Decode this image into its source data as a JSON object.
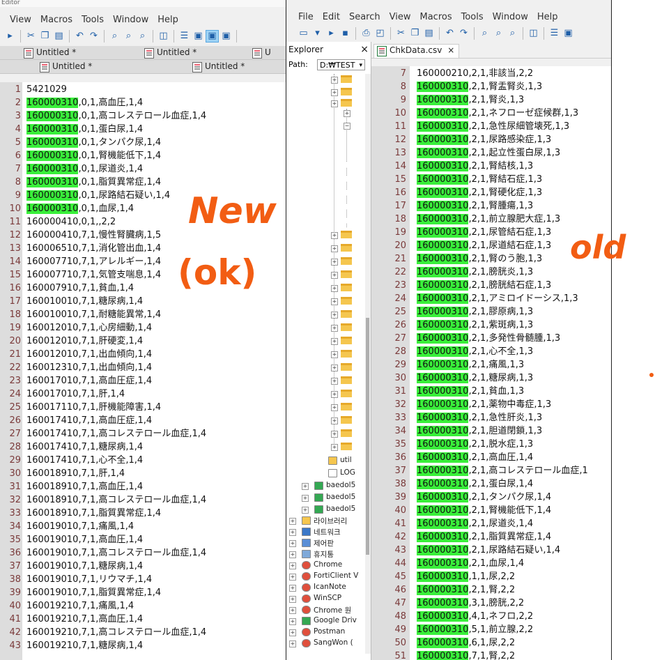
{
  "left_window": {
    "title_fragment": "Editor",
    "menu": [
      "View",
      "Macros",
      "Tools",
      "Window",
      "Help"
    ],
    "tabs_row1": [
      "Untitled *",
      "Untitled *",
      "U"
    ],
    "tabs_row2": [
      "Untitled *",
      "Untitled *"
    ],
    "lines": [
      {
        "n": "1",
        "hl": "",
        "rest": "5421029"
      },
      {
        "n": "2",
        "hl": "160000310",
        "rest": ",0,1,高血圧,1,4"
      },
      {
        "n": "3",
        "hl": "160000310",
        "rest": ",0,1,高コレステロール血症,1,4"
      },
      {
        "n": "4",
        "hl": "160000310",
        "rest": ",0,1,蛋白尿,1,4"
      },
      {
        "n": "5",
        "hl": "160000310",
        "rest": ",0,1,タンパク尿,1,4"
      },
      {
        "n": "6",
        "hl": "160000310",
        "rest": ",0,1,腎機能低下,1,4"
      },
      {
        "n": "7",
        "hl": "160000310",
        "rest": ",0,1,尿道炎,1,4"
      },
      {
        "n": "8",
        "hl": "160000310",
        "rest": ",0,1,脂質異常症,1,4"
      },
      {
        "n": "9",
        "hl": "160000310",
        "rest": ",0,1,尿路結石疑い,1,4"
      },
      {
        "n": "10",
        "hl": "160000310",
        "rest": ",0,1,血尿,1,4"
      },
      {
        "n": "11",
        "hl": "",
        "rest": "160000410,0,1,,2,2"
      },
      {
        "n": "12",
        "hl": "",
        "rest": "160000410,7,1,慢性腎臓病,1,5"
      },
      {
        "n": "13",
        "hl": "",
        "rest": "160006510,7,1,消化管出血,1,4"
      },
      {
        "n": "14",
        "hl": "",
        "rest": "160007710,7,1,アレルギー,1,4"
      },
      {
        "n": "15",
        "hl": "",
        "rest": "160007710,7,1,気管支喘息,1,4"
      },
      {
        "n": "16",
        "hl": "",
        "rest": "160007910,7,1,貧血,1,4"
      },
      {
        "n": "17",
        "hl": "",
        "rest": "160010010,7,1,糖尿病,1,4"
      },
      {
        "n": "18",
        "hl": "",
        "rest": "160010010,7,1,耐糖能異常,1,4"
      },
      {
        "n": "19",
        "hl": "",
        "rest": "160012010,7,1,心房細動,1,4"
      },
      {
        "n": "20",
        "hl": "",
        "rest": "160012010,7,1,肝硬変,1,4"
      },
      {
        "n": "21",
        "hl": "",
        "rest": "160012010,7,1,出血傾向,1,4"
      },
      {
        "n": "22",
        "hl": "",
        "rest": "160012310,7,1,出血傾向,1,4"
      },
      {
        "n": "23",
        "hl": "",
        "rest": "160017010,7,1,高血圧症,1,4"
      },
      {
        "n": "24",
        "hl": "",
        "rest": "160017010,7,1,肝,1,4"
      },
      {
        "n": "25",
        "hl": "",
        "rest": "160017110,7,1,肝機能障害,1,4"
      },
      {
        "n": "26",
        "hl": "",
        "rest": "160017410,7,1,高血圧症,1,4"
      },
      {
        "n": "27",
        "hl": "",
        "rest": "160017410,7,1,高コレステロール血症,1,4"
      },
      {
        "n": "28",
        "hl": "",
        "rest": "160017410,7,1,糖尿病,1,4"
      },
      {
        "n": "29",
        "hl": "",
        "rest": "160017410,7,1,心不全,1,4"
      },
      {
        "n": "30",
        "hl": "",
        "rest": "160018910,7,1,肝,1,4"
      },
      {
        "n": "31",
        "hl": "",
        "rest": "160018910,7,1,高血圧,1,4"
      },
      {
        "n": "32",
        "hl": "",
        "rest": "160018910,7,1,高コレステロール血症,1,4"
      },
      {
        "n": "33",
        "hl": "",
        "rest": "160018910,7,1,脂質異常症,1,4"
      },
      {
        "n": "34",
        "hl": "",
        "rest": "160019010,7,1,痛風,1,4"
      },
      {
        "n": "35",
        "hl": "",
        "rest": "160019010,7,1,高血圧,1,4"
      },
      {
        "n": "36",
        "hl": "",
        "rest": "160019010,7,1,高コレステロール血症,1,4"
      },
      {
        "n": "37",
        "hl": "",
        "rest": "160019010,7,1,糖尿病,1,4"
      },
      {
        "n": "38",
        "hl": "",
        "rest": "160019010,7,1,リウマチ,1,4"
      },
      {
        "n": "39",
        "hl": "",
        "rest": "160019010,7,1,脂質異常症,1,4"
      },
      {
        "n": "40",
        "hl": "",
        "rest": "160019210,7,1,痛風,1,4"
      },
      {
        "n": "41",
        "hl": "",
        "rest": "160019210,7,1,高血圧,1,4"
      },
      {
        "n": "42",
        "hl": "",
        "rest": "160019210,7,1,高コレステロール血症,1,4"
      },
      {
        "n": "43",
        "hl": "",
        "rest": "160019210,7,1,糖尿病,1,4"
      }
    ]
  },
  "right_window": {
    "menu": [
      "File",
      "Edit",
      "Search",
      "View",
      "Macros",
      "Tools",
      "Window",
      "Help"
    ],
    "explorer": {
      "title": "Explorer",
      "close": "×",
      "path_label": "Path:",
      "path_value": "D:₩TEST",
      "items": [
        "util",
        "LOG",
        "baedol5",
        "baedol5",
        "baedol5",
        "라이브러리",
        "네트워크",
        "제어판",
        "휴지통",
        "Chrome",
        "FortiClient V",
        "IcanNote",
        "WinSCP",
        "Chrome 원",
        "Google Driv",
        "Postman",
        "SangWon ("
      ]
    },
    "tab_label": "ChkData.csv",
    "tab_close": "×",
    "lines": [
      {
        "n": "7",
        "hl": "",
        "rest": "160000210,2,1,非該当,2,2"
      },
      {
        "n": "8",
        "hl": "160000310",
        "rest": ",2,1,腎盂腎炎,1,3"
      },
      {
        "n": "9",
        "hl": "160000310",
        "rest": ",2,1,腎炎,1,3"
      },
      {
        "n": "10",
        "hl": "160000310",
        "rest": ",2,1,ネフローゼ症候群,1,3"
      },
      {
        "n": "11",
        "hl": "160000310",
        "rest": ",2,1,急性尿細管壊死,1,3"
      },
      {
        "n": "12",
        "hl": "160000310",
        "rest": ",2,1,尿路感染症,1,3"
      },
      {
        "n": "13",
        "hl": "160000310",
        "rest": ",2,1,起立性蛋白尿,1,3"
      },
      {
        "n": "14",
        "hl": "160000310",
        "rest": ",2,1,腎結核,1,3"
      },
      {
        "n": "15",
        "hl": "160000310",
        "rest": ",2,1,腎結石症,1,3"
      },
      {
        "n": "16",
        "hl": "160000310",
        "rest": ",2,1,腎硬化症,1,3"
      },
      {
        "n": "17",
        "hl": "160000310",
        "rest": ",2,1,腎腫瘍,1,3"
      },
      {
        "n": "18",
        "hl": "160000310",
        "rest": ",2,1,前立腺肥大症,1,3"
      },
      {
        "n": "19",
        "hl": "160000310",
        "rest": ",2,1,尿管結石症,1,3"
      },
      {
        "n": "20",
        "hl": "160000310",
        "rest": ",2,1,尿道結石症,1,3"
      },
      {
        "n": "21",
        "hl": "160000310",
        "rest": ",2,1,腎のう胞,1,3"
      },
      {
        "n": "22",
        "hl": "160000310",
        "rest": ",2,1,膀胱炎,1,3"
      },
      {
        "n": "23",
        "hl": "160000310",
        "rest": ",2,1,膀胱結石症,1,3"
      },
      {
        "n": "24",
        "hl": "160000310",
        "rest": ",2,1,アミロイドーシス,1,3"
      },
      {
        "n": "25",
        "hl": "160000310",
        "rest": ",2,1,膠原病,1,3"
      },
      {
        "n": "26",
        "hl": "160000310",
        "rest": ",2,1,紫斑病,1,3"
      },
      {
        "n": "27",
        "hl": "160000310",
        "rest": ",2,1,多発性骨髄腫,1,3"
      },
      {
        "n": "28",
        "hl": "160000310",
        "rest": ",2,1,心不全,1,3"
      },
      {
        "n": "29",
        "hl": "160000310",
        "rest": ",2,1,痛風,1,3"
      },
      {
        "n": "30",
        "hl": "160000310",
        "rest": ",2,1,糖尿病,1,3"
      },
      {
        "n": "31",
        "hl": "160000310",
        "rest": ",2,1,貧血,1,3"
      },
      {
        "n": "32",
        "hl": "160000310",
        "rest": ",2,1,薬物中毒症,1,3"
      },
      {
        "n": "33",
        "hl": "160000310",
        "rest": ",2,1,急性肝炎,1,3"
      },
      {
        "n": "34",
        "hl": "160000310",
        "rest": ",2,1,胆道閉鎖,1,3"
      },
      {
        "n": "35",
        "hl": "160000310",
        "rest": ",2,1,脱水症,1,3"
      },
      {
        "n": "36",
        "hl": "160000310",
        "rest": ",2,1,高血圧,1,4"
      },
      {
        "n": "37",
        "hl": "160000310",
        "rest": ",2,1,高コレステロール血症,1"
      },
      {
        "n": "38",
        "hl": "160000310",
        "rest": ",2,1,蛋白尿,1,4"
      },
      {
        "n": "39",
        "hl": "160000310",
        "rest": ",2,1,タンパク尿,1,4"
      },
      {
        "n": "40",
        "hl": "160000310",
        "rest": ",2,1,腎機能低下,1,4"
      },
      {
        "n": "41",
        "hl": "160000310",
        "rest": ",2,1,尿道炎,1,4"
      },
      {
        "n": "42",
        "hl": "160000310",
        "rest": ",2,1,脂質異常症,1,4"
      },
      {
        "n": "43",
        "hl": "160000310",
        "rest": ",2,1,尿路結石疑い,1,4"
      },
      {
        "n": "44",
        "hl": "160000310",
        "rest": ",2,1,血尿,1,4"
      },
      {
        "n": "45",
        "hl": "160000310",
        "rest": ",1,1,尿,2,2"
      },
      {
        "n": "46",
        "hl": "160000310",
        "rest": ",2,1,腎,2,2"
      },
      {
        "n": "47",
        "hl": "160000310",
        "rest": ",3,1,膀胱,2,2"
      },
      {
        "n": "48",
        "hl": "160000310",
        "rest": ",4,1,ネフロ,2,2"
      },
      {
        "n": "49",
        "hl": "160000310",
        "rest": ",5,1,前立腺,2,2"
      },
      {
        "n": "50",
        "hl": "160000310",
        "rest": ",6,1,尿,2,2"
      },
      {
        "n": "51",
        "hl": "160000310",
        "rest": ",7,1,腎,2,2"
      }
    ]
  },
  "annotations": {
    "new": "New",
    "ok": "(ok)",
    "old": "old",
    "color": "#f25d13"
  },
  "colors": {
    "highlight": "#39ef3a",
    "gutter": "#dddddd"
  }
}
